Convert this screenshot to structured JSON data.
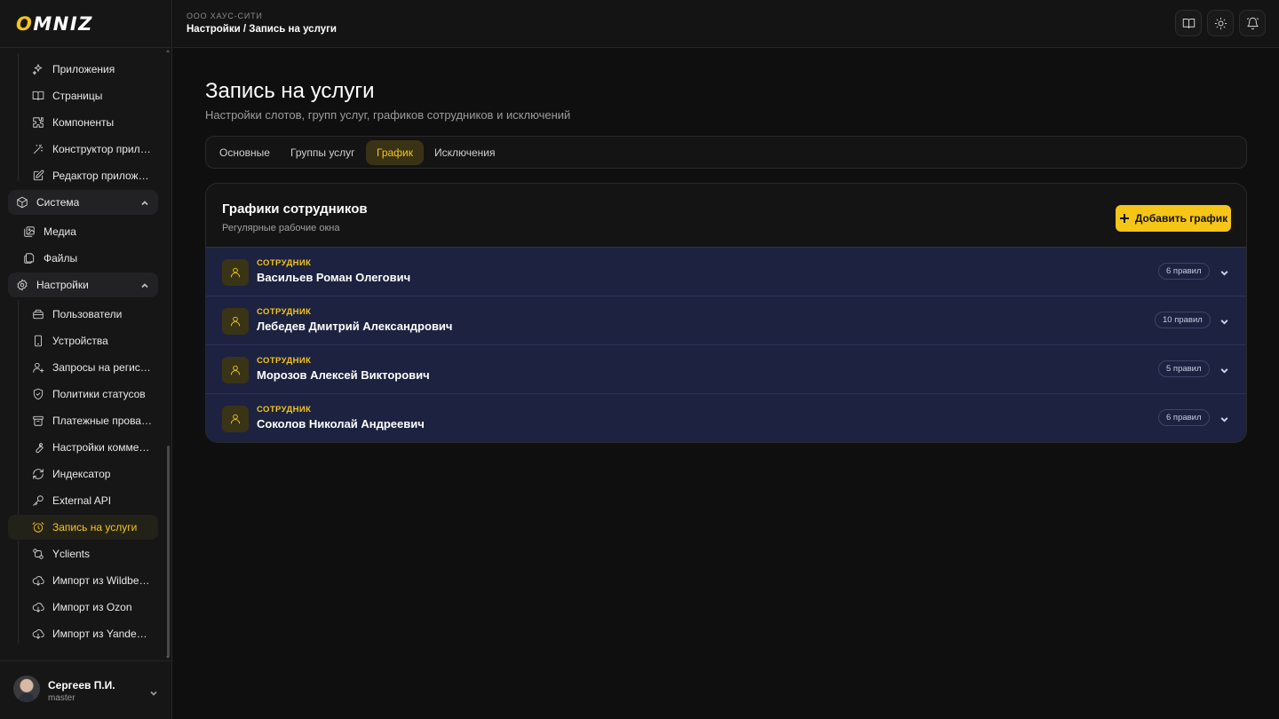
{
  "app": {
    "logo": "OMNIZ"
  },
  "sidebar": {
    "items": [
      {
        "label": "Приложения",
        "icon": "sparkles-icon"
      },
      {
        "label": "Страницы",
        "icon": "book-icon"
      },
      {
        "label": "Компоненты",
        "icon": "puzzle-icon"
      },
      {
        "label": "Конструктор приложений",
        "icon": "magic-wand-icon"
      },
      {
        "label": "Редактор приложений",
        "icon": "edit-icon"
      }
    ],
    "system": {
      "label": "Система",
      "icon": "cube-icon"
    },
    "system_items": [
      {
        "label": "Медиа",
        "icon": "images-icon"
      },
      {
        "label": "Файлы",
        "icon": "files-icon"
      }
    ],
    "settings": {
      "label": "Настройки",
      "icon": "gear-icon"
    },
    "settings_items": [
      {
        "label": "Пользователи",
        "icon": "users-icon"
      },
      {
        "label": "Устройства",
        "icon": "smartphone-icon"
      },
      {
        "label": "Запросы на регистрацию",
        "icon": "user-plus-icon"
      },
      {
        "label": "Политики статусов",
        "icon": "shield-icon"
      },
      {
        "label": "Платежные провайдеры",
        "icon": "archive-icon"
      },
      {
        "label": "Настройки коммерции",
        "icon": "wrench-icon"
      },
      {
        "label": "Индексатор",
        "icon": "refresh-icon"
      },
      {
        "label": "External API",
        "icon": "key-icon"
      },
      {
        "label": "Запись на услуги",
        "icon": "alarm-clock-icon",
        "active": true
      },
      {
        "label": "Yclients",
        "icon": "swap-icon"
      },
      {
        "label": "Импорт из Wildberries",
        "icon": "cloud-download-icon"
      },
      {
        "label": "Импорт из Ozon",
        "icon": "cloud-download-icon"
      },
      {
        "label": "Импорт из Yandex Market",
        "icon": "cloud-download-icon"
      }
    ]
  },
  "user": {
    "name": "Сергеев П.И.",
    "role": "master"
  },
  "header": {
    "org": "ООО ХАУС-СИТИ",
    "breadcrumb": "Настройки / Запись на услуги"
  },
  "page": {
    "title": "Запись на услуги",
    "subtitle": "Настройки слотов, групп услуг, графиков сотрудников и исключений"
  },
  "tabs": [
    {
      "label": "Основные"
    },
    {
      "label": "Группы услуг"
    },
    {
      "label": "График",
      "active": true
    },
    {
      "label": "Исключения"
    }
  ],
  "card": {
    "title": "Графики сотрудников",
    "subtitle": "Регулярные рабочие окна",
    "add_label": "Добавить график"
  },
  "employees": [
    {
      "kind": "СОТРУДНИК",
      "name": "Васильев Роман Олегович",
      "rules": "6 правил"
    },
    {
      "kind": "СОТРУДНИК",
      "name": "Лебедев Дмитрий Александрович",
      "rules": "10 правил"
    },
    {
      "kind": "СОТРУДНИК",
      "name": "Морозов Алексей Викторович",
      "rules": "5 правил"
    },
    {
      "kind": "СОТРУДНИК",
      "name": "Соколов Николай Андреевич",
      "rules": "6 правил"
    }
  ],
  "colors": {
    "accent": "#f5c518",
    "row_bg": "#1c2240",
    "background": "#0f0f10"
  }
}
